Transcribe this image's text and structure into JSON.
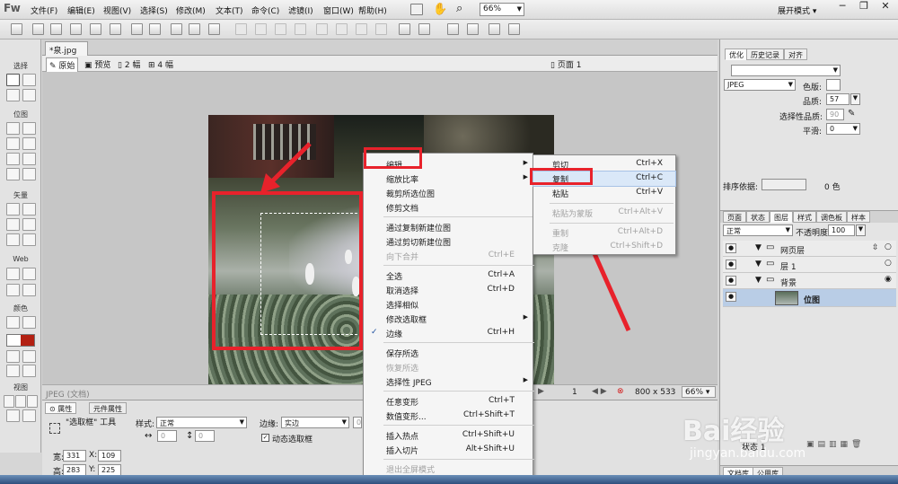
{
  "app": {
    "logo": "Fw"
  },
  "menubar": {
    "items": [
      "文件(F)",
      "编辑(E)",
      "视图(V)",
      "选择(S)",
      "修改(M)",
      "文本(T)",
      "命令(C)",
      "滤镜(I)",
      "窗口(W)",
      "帮助(H)"
    ],
    "zoom": "66%",
    "workspace": "展开模式"
  },
  "document": {
    "tab_title": "*泉.jpg",
    "view_modes": [
      "原始",
      "预览",
      "2 幅",
      "4 幅"
    ],
    "page": "页面 1"
  },
  "tools": {
    "sections": [
      "选择",
      "位图",
      "矢量",
      "Web",
      "颜色",
      "视图"
    ]
  },
  "status": {
    "file": "JPEG (文档)",
    "frame": "1",
    "size": "800 x 533",
    "zoom": "66%"
  },
  "properties": {
    "tabs": [
      "属性",
      "元件属性"
    ],
    "tool_name": "\"选取框\" 工具",
    "style_label": "样式:",
    "style_value": "正常",
    "edge_label": "边缘:",
    "edge_value": "实边",
    "style_w": "0",
    "style_h": "0",
    "edge_num": "0",
    "dynamic_marquee": "动态选取框",
    "w_label": "宽:",
    "w": "331",
    "x_label": "X:",
    "x": "109",
    "h_label": "高:",
    "h": "283",
    "y_label": "Y:",
    "y": "225"
  },
  "optimize": {
    "tabs": [
      "优化",
      "历史记录",
      "对齐"
    ],
    "format": "JPEG",
    "matte_label": "色版:",
    "quality_label": "品质:",
    "quality": "57",
    "selective_label": "选择性品质:",
    "selective_value": "90",
    "smoothing_label": "平滑:",
    "smoothing": "0",
    "sort_label": "排序依据:",
    "colors": "0 色"
  },
  "layers": {
    "tabs": [
      "页面",
      "状态",
      "图层",
      "样式",
      "调色板",
      "样本"
    ],
    "blend": "正常",
    "opacity_label": "不透明度",
    "opacity": "100",
    "rows": [
      {
        "name": "网页层"
      },
      {
        "name": "层 1"
      },
      {
        "name": "背景"
      },
      {
        "name": "位图"
      }
    ],
    "state": "状态 1",
    "bottom_tabs": [
      "文档库",
      "公用库"
    ]
  },
  "context_menu": {
    "items": [
      {
        "label": "编辑",
        "shortcut": "",
        "submenu": true,
        "disabled": false
      },
      {
        "label": "缩放比率",
        "shortcut": "",
        "submenu": true,
        "disabled": false
      },
      {
        "label": "裁剪所选位图",
        "shortcut": "",
        "submenu": false,
        "disabled": false
      },
      {
        "label": "修剪文档",
        "shortcut": "",
        "submenu": false,
        "disabled": false
      },
      {
        "label": "通过复制新建位图",
        "shortcut": "",
        "submenu": false,
        "disabled": false
      },
      {
        "label": "通过剪切新建位图",
        "shortcut": "",
        "submenu": false,
        "disabled": false
      },
      {
        "label": "向下合并",
        "shortcut": "Ctrl+E",
        "submenu": false,
        "disabled": true
      },
      {
        "label": "全选",
        "shortcut": "Ctrl+A",
        "submenu": false,
        "disabled": false
      },
      {
        "label": "取消选择",
        "shortcut": "Ctrl+D",
        "submenu": false,
        "disabled": false
      },
      {
        "label": "选择相似",
        "shortcut": "",
        "submenu": false,
        "disabled": false
      },
      {
        "label": "修改选取框",
        "shortcut": "",
        "submenu": true,
        "disabled": false
      },
      {
        "label": "边缘",
        "shortcut": "Ctrl+H",
        "submenu": false,
        "disabled": false
      },
      {
        "label": "保存所选",
        "shortcut": "",
        "submenu": false,
        "disabled": false
      },
      {
        "label": "恢复所选",
        "shortcut": "",
        "submenu": false,
        "disabled": true
      },
      {
        "label": "选择性 JPEG",
        "shortcut": "",
        "submenu": true,
        "disabled": false
      },
      {
        "label": "任意变形",
        "shortcut": "Ctrl+T",
        "submenu": false,
        "disabled": false
      },
      {
        "label": "数值变形...",
        "shortcut": "Ctrl+Shift+T",
        "submenu": false,
        "disabled": false
      },
      {
        "label": "插入热点",
        "shortcut": "Ctrl+Shift+U",
        "submenu": false,
        "disabled": false
      },
      {
        "label": "插入切片",
        "shortcut": "Alt+Shift+U",
        "submenu": false,
        "disabled": false
      },
      {
        "label": "退出全屏模式",
        "shortcut": "",
        "submenu": false,
        "disabled": true
      }
    ],
    "checked": "✓"
  },
  "submenu": {
    "items": [
      {
        "label": "剪切",
        "shortcut": "Ctrl+X",
        "disabled": false
      },
      {
        "label": "复制",
        "shortcut": "Ctrl+C",
        "disabled": false
      },
      {
        "label": "粘贴",
        "shortcut": "Ctrl+V",
        "disabled": false
      },
      {
        "label": "粘贴为蒙版",
        "shortcut": "Ctrl+Alt+V",
        "disabled": true
      },
      {
        "label": "重制",
        "shortcut": "Ctrl+Alt+D",
        "disabled": true
      },
      {
        "label": "克隆",
        "shortcut": "Ctrl+Shift+D",
        "disabled": true
      }
    ]
  },
  "watermark": {
    "brand": "Bai经验",
    "url": "jingyan.baidu.com"
  },
  "colors": {
    "highlight_red": "#e8222b",
    "menu_hover": "#dae8f8",
    "layer_selected": "#b9cde6"
  }
}
